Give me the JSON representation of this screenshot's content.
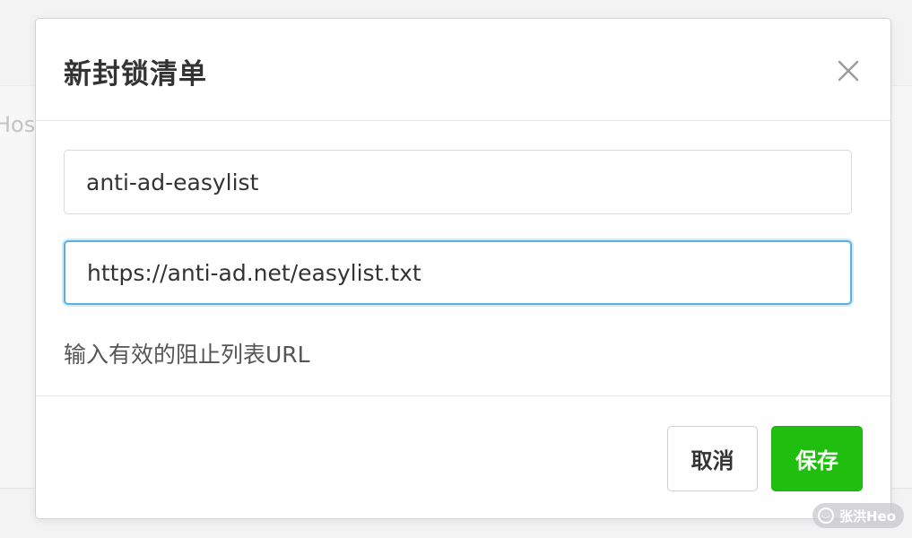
{
  "background": {
    "partial_text": "Hos"
  },
  "modal": {
    "title": "新封锁清单",
    "close_icon": "close-icon",
    "name_field": {
      "value": "anti-ad-easylist",
      "placeholder": ""
    },
    "url_field": {
      "value": "https://anti-ad.net/easylist.txt",
      "placeholder": ""
    },
    "help_text": "输入有效的阻止列表URL",
    "buttons": {
      "cancel_label": "取消",
      "save_label": "保存"
    }
  },
  "watermark": {
    "text": "张洪Heo"
  },
  "colors": {
    "primary": "#20bf0f",
    "focus_border": "#5aaee8"
  }
}
